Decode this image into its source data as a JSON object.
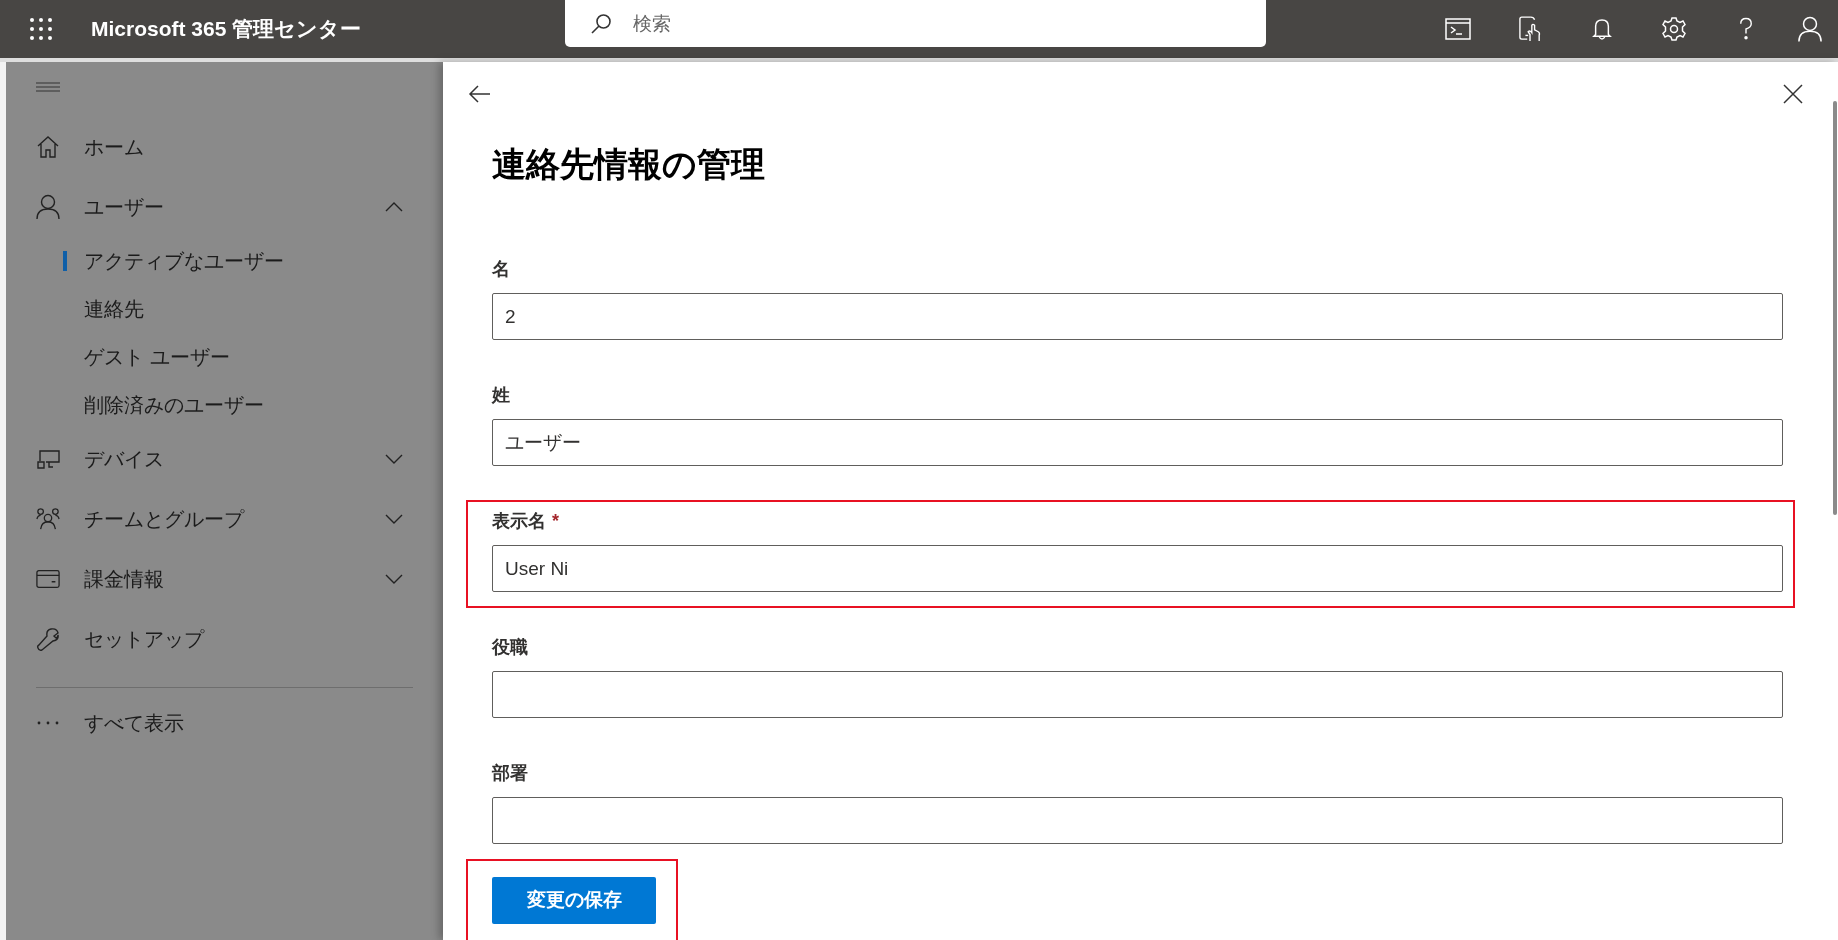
{
  "app": {
    "title": "Microsoft 365 管理センター",
    "search": {
      "placeholder": "検索"
    }
  },
  "sidebar": {
    "items": [
      {
        "kind": "link",
        "label": "ホーム",
        "selected": false
      },
      {
        "kind": "group",
        "label": "ユーザー",
        "selected": false,
        "expanded": true,
        "children": [
          {
            "label": "アクティブなユーザー",
            "selected": true
          },
          {
            "label": "連絡先",
            "selected": false
          },
          {
            "label": "ゲスト ユーザー",
            "selected": false
          },
          {
            "label": "削除済みのユーザー",
            "selected": false
          }
        ]
      },
      {
        "kind": "group",
        "label": "デバイス",
        "selected": false,
        "expanded": false
      },
      {
        "kind": "group",
        "label": "チームとグループ",
        "selected": false,
        "expanded": false
      },
      {
        "kind": "group",
        "label": "課金情報",
        "selected": false,
        "expanded": false
      },
      {
        "kind": "link",
        "label": "セットアップ",
        "selected": false
      },
      {
        "kind": "more",
        "label": "すべて表示",
        "selected": false
      }
    ]
  },
  "panel": {
    "title": "連絡先情報の管理",
    "fields": [
      {
        "label": "名",
        "value": "2",
        "highlighted": false
      },
      {
        "label": "姓",
        "value": "ユーザー",
        "highlighted": false
      },
      {
        "label": "表示名",
        "required_mark": "*",
        "value": "User Ni",
        "highlighted": true
      },
      {
        "label": "役職",
        "highlighted": false
      },
      {
        "label": "部署",
        "highlighted": false
      }
    ],
    "save_button": {
      "label": "変更の保存",
      "highlighted": true
    }
  }
}
